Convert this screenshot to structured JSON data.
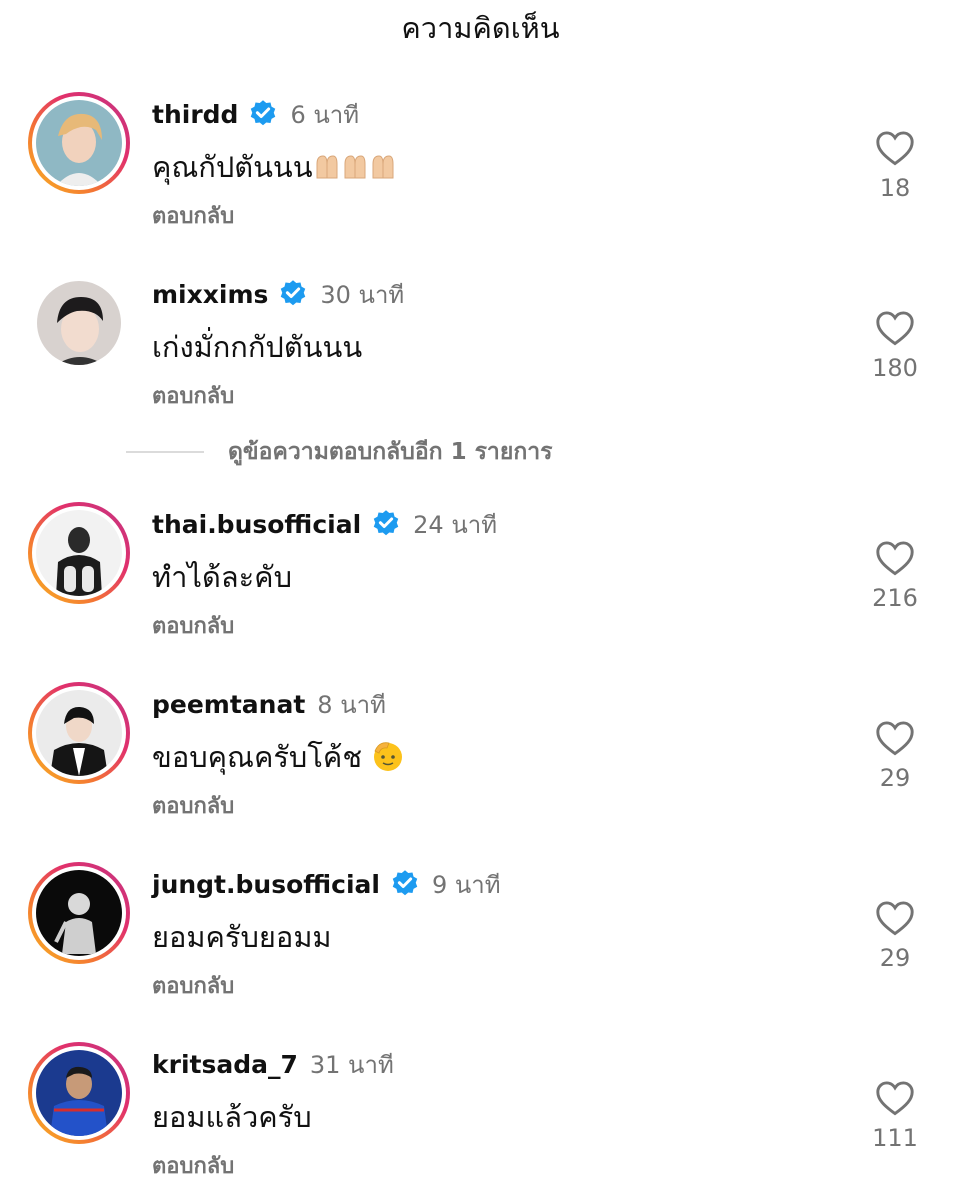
{
  "header": {
    "title": "ความคิดเห็น"
  },
  "colors": {
    "verified": "#1d9bf0",
    "meta_gray": "#737373",
    "ring_start": "#f9b820",
    "ring_end": "#c13584"
  },
  "comments": [
    {
      "username": "thirdd",
      "verified": true,
      "time": "6 นาที",
      "text": "คุณกัปตันนน",
      "emoji": "raised-hands ×3",
      "reply": "ตอบกลับ",
      "likes": "18",
      "avatar": "avatar-thirdd"
    },
    {
      "username": "mixxims",
      "verified": true,
      "time": "30 นาที",
      "text": "เก่งมั่กกกัปตันนน",
      "reply": "ตอบกลับ",
      "likes": "180",
      "avatar": "avatar-mixxims"
    },
    {
      "username": "thai.busofficial",
      "verified": true,
      "time": "24 นาที",
      "text": "ทำได้ละคับ",
      "reply": "ตอบกลับ",
      "likes": "216",
      "avatar": "avatar-thai-bus"
    },
    {
      "username": "peemtanat",
      "verified": false,
      "time": "8 นาที",
      "text": "ขอบคุณครับโค้ช",
      "emoji": "saluting-face",
      "reply": "ตอบกลับ",
      "likes": "29",
      "avatar": "avatar-peemtanat"
    },
    {
      "username": "jungt.busofficial",
      "verified": true,
      "time": "9 นาที",
      "text": "ยอมครับยอมม",
      "reply": "ตอบกลับ",
      "likes": "29",
      "avatar": "avatar-jungt"
    },
    {
      "username": "kritsada_7",
      "verified": false,
      "time": "31 นาที",
      "text": "ยอมแล้วครับ",
      "reply": "ตอบกลับ",
      "likes": "111",
      "avatar": "avatar-kritsada"
    }
  ],
  "view_more_replies": "ดูข้อความตอบกลับอีก 1 รายการ"
}
